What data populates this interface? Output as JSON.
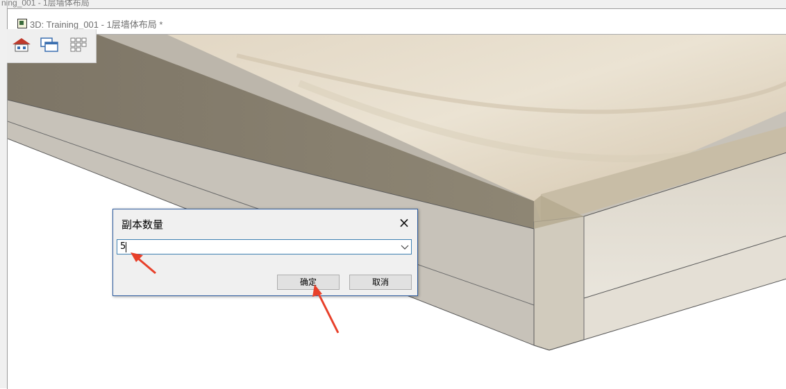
{
  "app": {
    "top_strip_text": "ning_001 - 1层墙体布局"
  },
  "view_window": {
    "title": "3D: Training_001 - 1层墙体布局 *"
  },
  "toolbar": {
    "icons": [
      "home-view-icon",
      "window-cascade-icon",
      "view-grid-icon"
    ]
  },
  "dialog": {
    "title": "副本数量",
    "close_glyph": "×",
    "input_value": "5",
    "ok_label": "确定",
    "cancel_label": "取消"
  },
  "colors": {
    "annotation_arrow": "#e8402a",
    "dialog_border": "#2b5a9e",
    "input_border": "#3c7fb1"
  }
}
